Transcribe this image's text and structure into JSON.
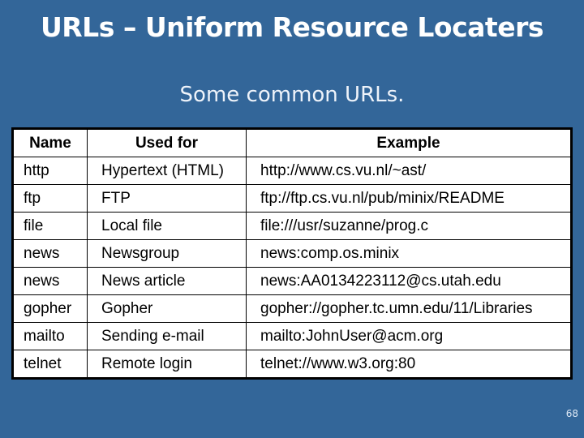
{
  "slide": {
    "title": "URLs – Uniform Resource Locaters",
    "subtitle": "Some common URLs.",
    "page_number": "68",
    "background_color": "#336699"
  },
  "table": {
    "headers": [
      "Name",
      "Used for",
      "Example"
    ],
    "rows": [
      [
        "http",
        "Hypertext (HTML)",
        "http://www.cs.vu.nl/~ast/"
      ],
      [
        "ftp",
        "FTP",
        "ftp://ftp.cs.vu.nl/pub/minix/README"
      ],
      [
        "file",
        "Local file",
        "file:///usr/suzanne/prog.c"
      ],
      [
        "news",
        "Newsgroup",
        "news:comp.os.minix"
      ],
      [
        "news",
        "News article",
        "news:AA0134223112@cs.utah.edu"
      ],
      [
        "gopher",
        "Gopher",
        "gopher://gopher.tc.umn.edu/11/Libraries"
      ],
      [
        "mailto",
        "Sending e-mail",
        "mailto:JohnUser@acm.org"
      ],
      [
        "telnet",
        "Remote login",
        "telnet://www.w3.org:80"
      ]
    ]
  }
}
